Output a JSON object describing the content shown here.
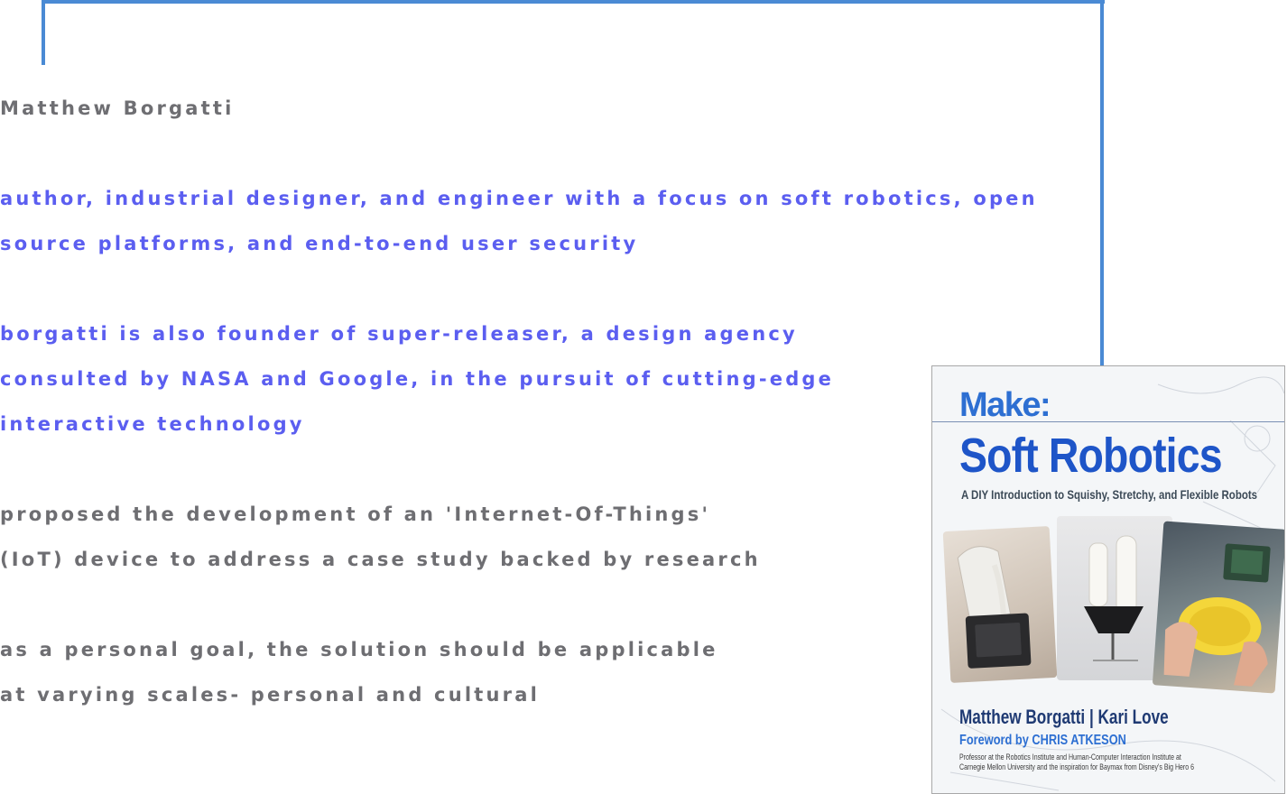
{
  "bio": {
    "name": "Matthew Borgatti",
    "role_line_1": "author, industrial designer, and engineer with a focus on soft robotics, open",
    "role_line_2": "source platforms, and end-to-end user security",
    "founder_line_1": "borgatti is also founder of super-releaser, a design agency",
    "founder_line_2": "consulted by NASA and Google, in the pursuit of cutting-edge",
    "founder_line_3": "interactive technology",
    "proposal_line_1": "proposed the development of an 'Internet-Of-Things'",
    "proposal_line_2": "(IoT) device to address a case study backed by research",
    "goal_line_1": "as a personal goal, the solution should be applicable",
    "goal_line_2": "at varying scales- personal and cultural"
  },
  "book_cover": {
    "brand": "Make:",
    "title": "Soft Robotics",
    "subtitle": "A DIY Introduction to Squishy, Stretchy, and Flexible Robots",
    "authors": "Matthew Borgatti | Kari Love",
    "foreword": "Foreword by CHRIS ATKESON",
    "blurb_line_1": "Professor at the Robotics Institute and Human-Computer Interaction Institute at",
    "blurb_line_2": "Carnegie Mellon University and the inspiration for Baymax from Disney's Big Hero 6"
  },
  "colors": {
    "frame": "#4a8ad4",
    "highlight_text": "#5b5ef0",
    "plain_text": "#6e6e72"
  }
}
